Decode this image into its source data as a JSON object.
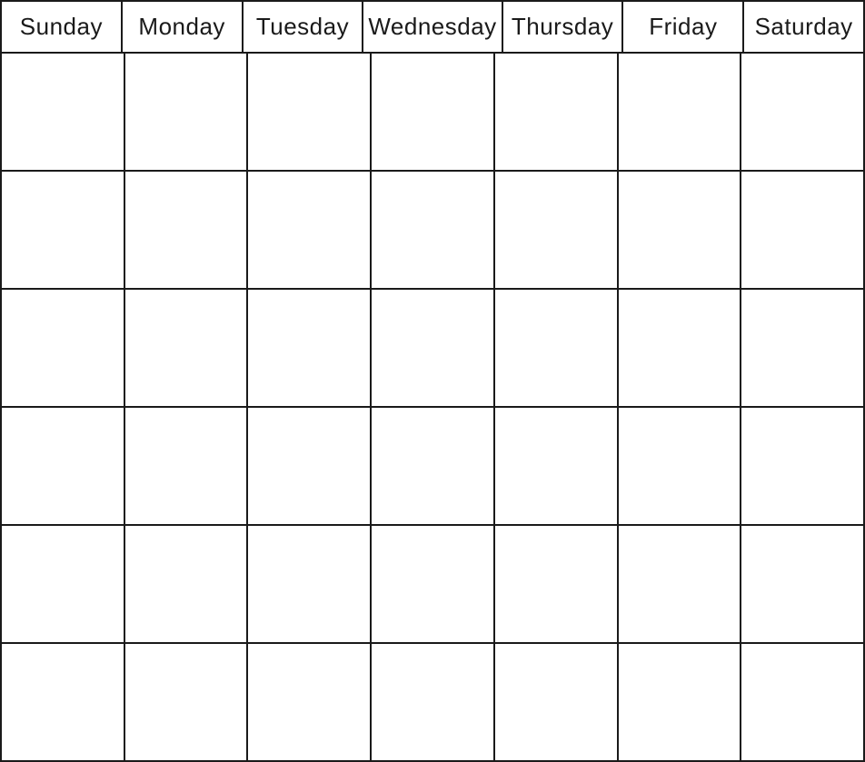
{
  "calendar": {
    "headers": [
      {
        "id": "sunday",
        "label": "Sunday"
      },
      {
        "id": "monday",
        "label": "Monday"
      },
      {
        "id": "tuesday",
        "label": "Tuesday"
      },
      {
        "id": "wednesday",
        "label": "Wednesday"
      },
      {
        "id": "thursday",
        "label": "Thursday"
      },
      {
        "id": "friday",
        "label": "Friday"
      },
      {
        "id": "saturday",
        "label": "Saturday"
      }
    ],
    "rows": 6
  }
}
